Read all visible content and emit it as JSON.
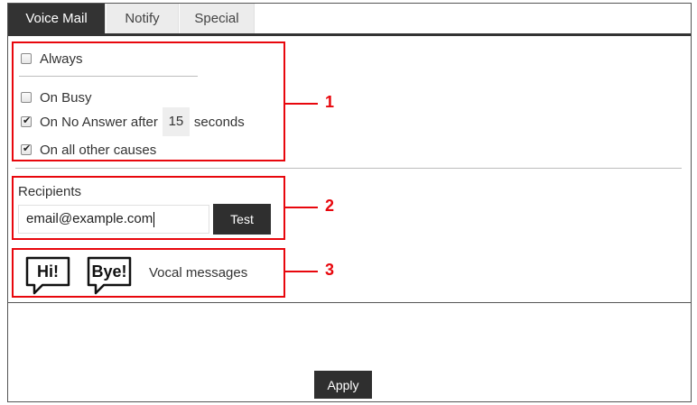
{
  "tabs": [
    {
      "label": "Voice Mail",
      "active": true
    },
    {
      "label": "Notify",
      "active": false
    },
    {
      "label": "Special",
      "active": false
    }
  ],
  "forwarding": {
    "always_label": "Always",
    "always_checked": false,
    "busy_label": "On Busy",
    "busy_checked": false,
    "no_answer_label": "On No Answer after",
    "no_answer_checked": true,
    "no_answer_seconds": "15",
    "seconds_label": "seconds",
    "other_label": "On all other causes",
    "other_checked": true
  },
  "recipients": {
    "label": "Recipients",
    "email_value": "email@example.com",
    "test_label": "Test"
  },
  "vocal": {
    "hi_text": "Hi!",
    "bye_text": "Bye!",
    "label": "Vocal messages"
  },
  "callouts": [
    "1",
    "2",
    "3"
  ],
  "apply_label": "Apply",
  "colors": {
    "accent_dark": "#333333",
    "highlight_red": "#e8070d",
    "tab_inactive": "#ececec"
  }
}
